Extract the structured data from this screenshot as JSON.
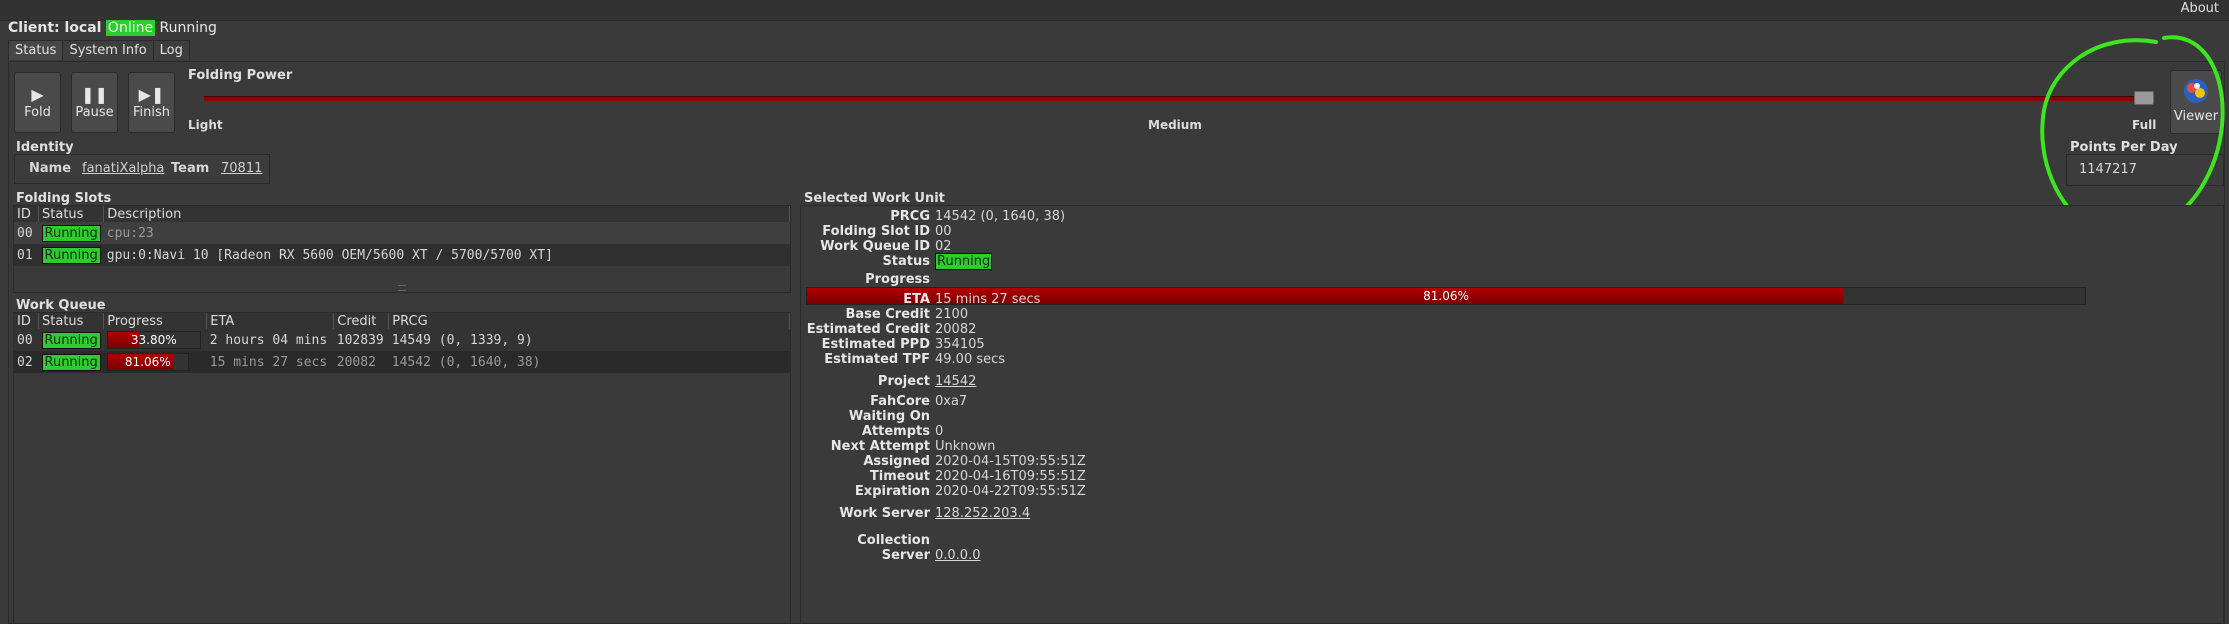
{
  "menubar": {
    "about": "About"
  },
  "client": {
    "label": "Client: local",
    "online": "Online",
    "state": "Running"
  },
  "tabs": [
    "Status",
    "System Info",
    "Log"
  ],
  "controls": {
    "fold": "Fold",
    "pause": "Pause",
    "finish": "Finish"
  },
  "folding_power": {
    "title": "Folding Power",
    "light": "Light",
    "medium": "Medium",
    "full": "Full",
    "level": 1.0
  },
  "viewer": {
    "label": "Viewer"
  },
  "identity": {
    "title": "Identity",
    "name_label": "Name",
    "name": "fanatiXalpha",
    "team_label": "Team",
    "team": "70811"
  },
  "ppd": {
    "title": "Points Per Day",
    "value": "1147217"
  },
  "folding_slots": {
    "title": "Folding Slots",
    "columns": [
      "ID",
      "Status",
      "Description"
    ],
    "rows": [
      {
        "id": "00",
        "status": "Running",
        "desc": "cpu:23"
      },
      {
        "id": "01",
        "status": "Running",
        "desc": "gpu:0:Navi 10 [Radeon RX 5600 OEM/5600 XT / 5700/5700 XT]"
      }
    ]
  },
  "work_queue": {
    "title": "Work Queue",
    "columns": [
      "ID",
      "Status",
      "Progress",
      "ETA",
      "Credit",
      "PRCG"
    ],
    "rows": [
      {
        "id": "00",
        "status": "Running",
        "progress": "33.80%",
        "progress_value": 0.338,
        "eta": "2 hours 04 mins",
        "credit": "102839",
        "prcg": "14549 (0, 1339, 9)"
      },
      {
        "id": "02",
        "status": "Running",
        "progress": "81.06%",
        "progress_value": 0.8106,
        "eta": "15 mins 27 secs",
        "credit": "20082",
        "prcg": "14542 (0, 1640, 38)"
      }
    ]
  },
  "selected_wu": {
    "title": "Selected Work Unit",
    "prcg_label": "PRCG",
    "prcg": "14542 (0, 1640, 38)",
    "slot_label": "Folding Slot ID",
    "slot": "00",
    "queue_label": "Work Queue ID",
    "queue": "02",
    "status_label": "Status",
    "status": "Running",
    "progress_label": "Progress",
    "progress": "81.06%",
    "progress_value": 0.8106,
    "eta_label": "ETA",
    "eta": "15 mins 27 secs",
    "base_credit_label": "Base Credit",
    "base_credit": "2100",
    "est_credit_label": "Estimated Credit",
    "est_credit": "20082",
    "est_ppd_label": "Estimated PPD",
    "est_ppd": "354105",
    "est_tpf_label": "Estimated TPF",
    "est_tpf": "49.00 secs",
    "project_label": "Project",
    "project": "14542",
    "fahcore_label": "FahCore",
    "fahcore": "0xa7",
    "waiting_label": "Waiting On",
    "waiting": "",
    "attempts_label": "Attempts",
    "attempts": "0",
    "next_attempt_label": "Next Attempt",
    "next_attempt": "Unknown",
    "assigned_label": "Assigned",
    "assigned": "2020-04-15T09:55:51Z",
    "timeout_label": "Timeout",
    "timeout": "2020-04-16T09:55:51Z",
    "expiration_label": "Expiration",
    "expiration": "2020-04-22T09:55:51Z",
    "work_server_label": "Work Server",
    "work_server": "128.252.203.4",
    "collection_server_label": "Collection Server",
    "collection_server": "0.0.0.0"
  },
  "colors": {
    "running": "#2ecc2e",
    "progress": "#8b0000",
    "annotation": "#3ee51f"
  }
}
